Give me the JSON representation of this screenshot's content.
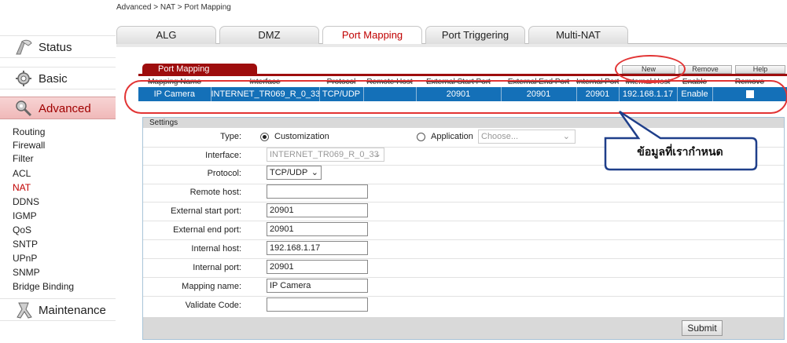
{
  "breadcrumb": "Advanced > NAT > Port Mapping",
  "tabs": [
    "ALG",
    "DMZ",
    "Port Mapping",
    "Port Triggering",
    "Multi-NAT"
  ],
  "active_tab": "Port Mapping",
  "sidebar": {
    "status": "Status",
    "basic": "Basic",
    "advanced": "Advanced",
    "advanced_items": [
      "Routing",
      "Firewall",
      "Filter",
      "ACL",
      "NAT",
      "DDNS",
      "IGMP",
      "QoS",
      "SNTP",
      "UPnP",
      "SNMP",
      "Bridge Binding"
    ],
    "active_item": "NAT",
    "maintenance": "Maintenance"
  },
  "panel": {
    "title": "Port Mapping",
    "buttons": {
      "new": "New",
      "remove": "Remove",
      "help": "Help"
    },
    "columns": [
      "Mapping Name",
      "Interface",
      "Protocol",
      "Remote Host",
      "External Start Port",
      "External End Port",
      "Internal Port",
      "Internal Host",
      "Enable",
      "Remove"
    ],
    "row": {
      "mapping_name": "IP Camera",
      "interface": "INTERNET_TR069_R_0_33",
      "protocol": "TCP/UDP",
      "remote_host": "",
      "external_start_port": "20901",
      "external_end_port": "20901",
      "internal_port": "20901",
      "internal_host": "192.168.1.17",
      "enable": "Enable"
    }
  },
  "settings": {
    "title": "Settings",
    "type_label": "Type:",
    "type_custom": "Customization",
    "type_app": "Application",
    "app_placeholder": "Choose...",
    "interface_label": "Interface:",
    "interface_value": "INTERNET_TR069_R_0_33",
    "protocol_label": "Protocol:",
    "protocol_value": "TCP/UDP",
    "remote_host_label": "Remote host:",
    "remote_host_value": "",
    "ext_start_label": "External start port:",
    "ext_start_value": "20901",
    "ext_end_label": "External end port:",
    "ext_end_value": "20901",
    "int_host_label": "Internal host:",
    "int_host_value": "192.168.1.17",
    "int_port_label": "Internal port:",
    "int_port_value": "20901",
    "mapping_name_label": "Mapping name:",
    "mapping_name_value": "IP Camera",
    "validate_label": "Validate Code:",
    "validate_value": "",
    "submit": "Submit"
  },
  "annotation": {
    "callout": "ข้อมูลที่เรากำหนด"
  }
}
